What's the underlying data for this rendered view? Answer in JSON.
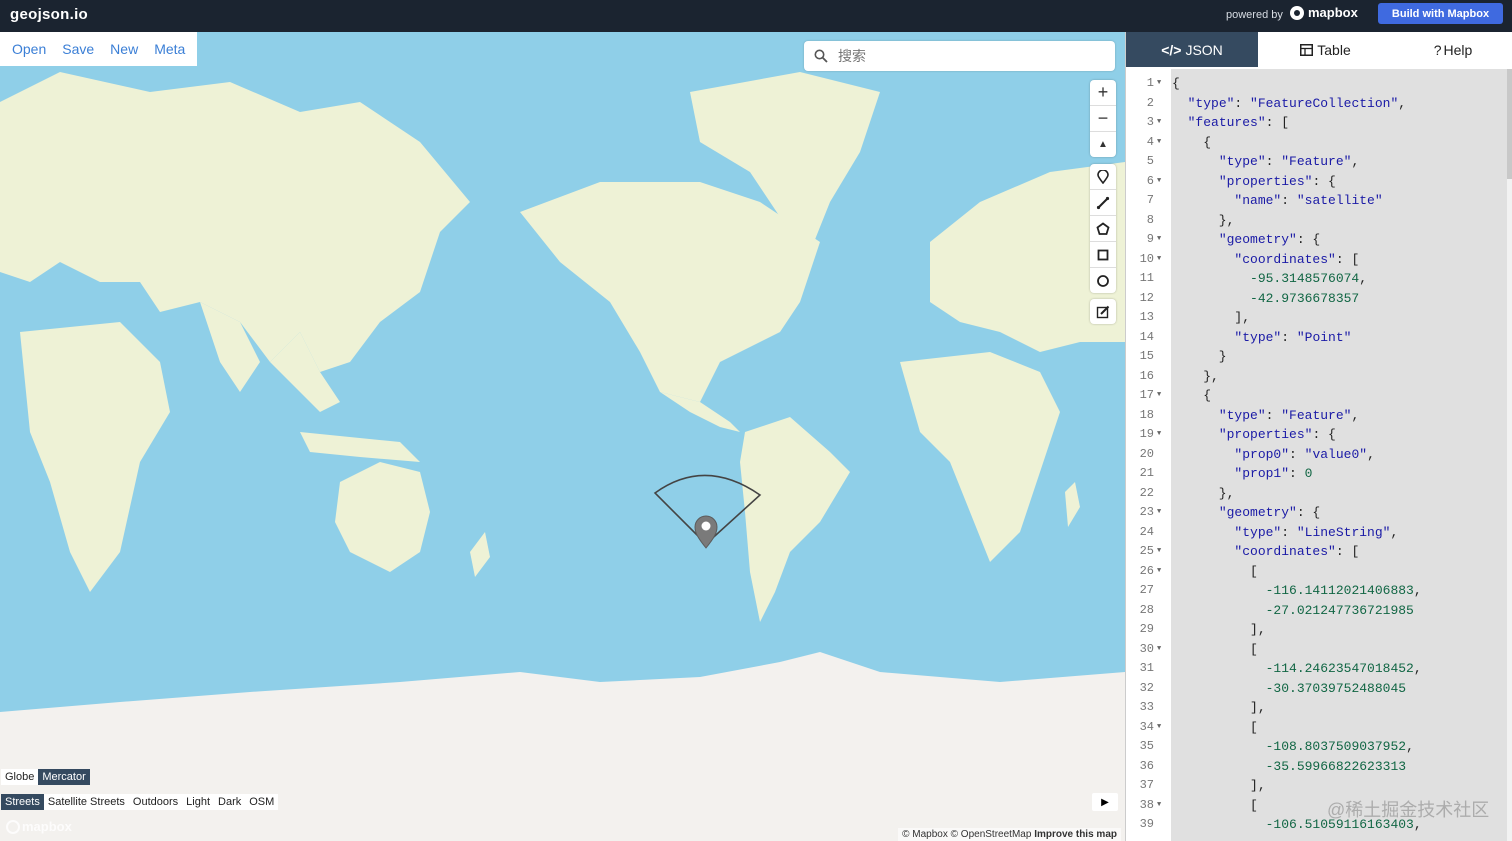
{
  "header": {
    "brand": "geojson.io",
    "powered_by": "powered by",
    "mapbox_logo": "mapbox",
    "build_button": "Build with Mapbox"
  },
  "menu": [
    "Open",
    "Save",
    "New",
    "Meta"
  ],
  "search": {
    "placeholder": "搜索"
  },
  "controls": {
    "zoom_in": "+",
    "zoom_out": "−",
    "compass": "▲"
  },
  "projection": {
    "options": [
      "Globe",
      "Mercator"
    ],
    "selected": "Mercator"
  },
  "map_styles": {
    "options": [
      "Streets",
      "Satellite Streets",
      "Outdoors",
      "Light",
      "Dark",
      "OSM"
    ],
    "selected": "Streets"
  },
  "attribution": {
    "mapbox": "© Mapbox",
    "osm": "© OpenStreetMap",
    "improve": "Improve this map"
  },
  "map_watermark": "mapbox",
  "tabs": [
    {
      "label": "JSON",
      "icon": "code-icon",
      "active": true
    },
    {
      "label": "Table",
      "icon": "table-icon",
      "active": false
    },
    {
      "label": "Help",
      "icon": "question-icon",
      "active": false
    }
  ],
  "editor_lines": [
    {
      "n": "1",
      "fold": true,
      "text": "{"
    },
    {
      "n": "2",
      "fold": false,
      "text": "  \"type\": \"FeatureCollection\","
    },
    {
      "n": "3",
      "fold": true,
      "text": "  \"features\": ["
    },
    {
      "n": "4",
      "fold": true,
      "text": "    {"
    },
    {
      "n": "5",
      "fold": false,
      "text": "      \"type\": \"Feature\","
    },
    {
      "n": "6",
      "fold": true,
      "text": "      \"properties\": {"
    },
    {
      "n": "7",
      "fold": false,
      "text": "        \"name\": \"satellite\""
    },
    {
      "n": "8",
      "fold": false,
      "text": "      },"
    },
    {
      "n": "9",
      "fold": true,
      "text": "      \"geometry\": {"
    },
    {
      "n": "10",
      "fold": true,
      "text": "        \"coordinates\": ["
    },
    {
      "n": "11",
      "fold": false,
      "text": "          -95.3148576074,"
    },
    {
      "n": "12",
      "fold": false,
      "text": "          -42.9736678357"
    },
    {
      "n": "13",
      "fold": false,
      "text": "        ],"
    },
    {
      "n": "14",
      "fold": false,
      "text": "        \"type\": \"Point\""
    },
    {
      "n": "15",
      "fold": false,
      "text": "      }"
    },
    {
      "n": "16",
      "fold": false,
      "text": "    },"
    },
    {
      "n": "17",
      "fold": true,
      "text": "    {"
    },
    {
      "n": "18",
      "fold": false,
      "text": "      \"type\": \"Feature\","
    },
    {
      "n": "19",
      "fold": true,
      "text": "      \"properties\": {"
    },
    {
      "n": "20",
      "fold": false,
      "text": "        \"prop0\": \"value0\","
    },
    {
      "n": "21",
      "fold": false,
      "text": "        \"prop1\": 0"
    },
    {
      "n": "22",
      "fold": false,
      "text": "      },"
    },
    {
      "n": "23",
      "fold": true,
      "text": "      \"geometry\": {"
    },
    {
      "n": "24",
      "fold": false,
      "text": "        \"type\": \"LineString\","
    },
    {
      "n": "25",
      "fold": true,
      "text": "        \"coordinates\": ["
    },
    {
      "n": "26",
      "fold": true,
      "text": "          ["
    },
    {
      "n": "27",
      "fold": false,
      "text": "            -116.14112021406883,"
    },
    {
      "n": "28",
      "fold": false,
      "text": "            -27.021247736721985"
    },
    {
      "n": "29",
      "fold": false,
      "text": "          ],"
    },
    {
      "n": "30",
      "fold": true,
      "text": "          ["
    },
    {
      "n": "31",
      "fold": false,
      "text": "            -114.24623547018452,"
    },
    {
      "n": "32",
      "fold": false,
      "text": "            -30.37039752488045"
    },
    {
      "n": "33",
      "fold": false,
      "text": "          ],"
    },
    {
      "n": "34",
      "fold": true,
      "text": "          ["
    },
    {
      "n": "35",
      "fold": false,
      "text": "            -108.8037509037952,"
    },
    {
      "n": "36",
      "fold": false,
      "text": "            -35.59966822623313"
    },
    {
      "n": "37",
      "fold": false,
      "text": "          ],"
    },
    {
      "n": "38",
      "fold": true,
      "text": "          ["
    },
    {
      "n": "39",
      "fold": false,
      "text": "            -106.51059116163403,"
    }
  ],
  "page_watermark": "@稀土掘金技术社区",
  "colors": {
    "ocean": "#8fcfe8",
    "land": "#eef2d6",
    "ice": "#f3f1ee",
    "header_bg": "#1b2430",
    "accent": "#3f6ae0",
    "active_tab": "#354a60",
    "link": "#3b7fd6"
  }
}
